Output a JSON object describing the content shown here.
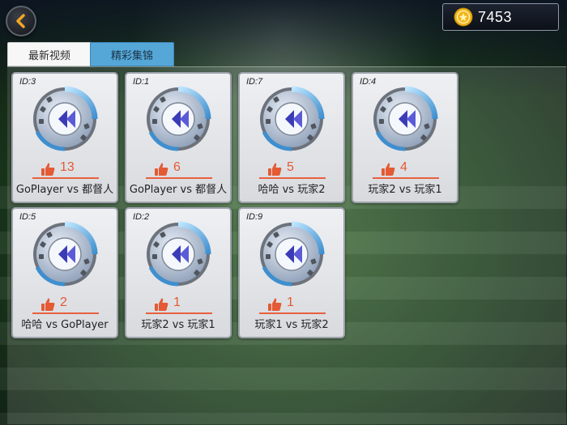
{
  "header": {
    "coins": "7453"
  },
  "tabs": [
    {
      "label": "最新视频",
      "active": false
    },
    {
      "label": "精彩集锦",
      "active": true
    }
  ],
  "videos": [
    {
      "id": "ID:3",
      "likes": "13",
      "match": "GoPlayer vs 都督人"
    },
    {
      "id": "ID:1",
      "likes": "6",
      "match": "GoPlayer vs 都督人"
    },
    {
      "id": "ID:7",
      "likes": "5",
      "match": "哈哈 vs 玩家2"
    },
    {
      "id": "ID:4",
      "likes": "4",
      "match": "玩家2 vs 玩家1"
    },
    {
      "id": "ID:5",
      "likes": "2",
      "match": "哈哈 vs GoPlayer"
    },
    {
      "id": "ID:2",
      "likes": "1",
      "match": "玩家2 vs 玩家1"
    },
    {
      "id": "ID:9",
      "likes": "1",
      "match": "玩家1 vs 玩家2"
    }
  ],
  "icons": {
    "back": "chevron-left-icon",
    "coin": "gold-coin-icon",
    "replay": "film-reel-replay-icon",
    "like": "thumbs-up-icon"
  },
  "colors": {
    "active_tab": "#55a7d8",
    "like_accent": "#e45a34",
    "card_bg": "#e6e8eb"
  }
}
